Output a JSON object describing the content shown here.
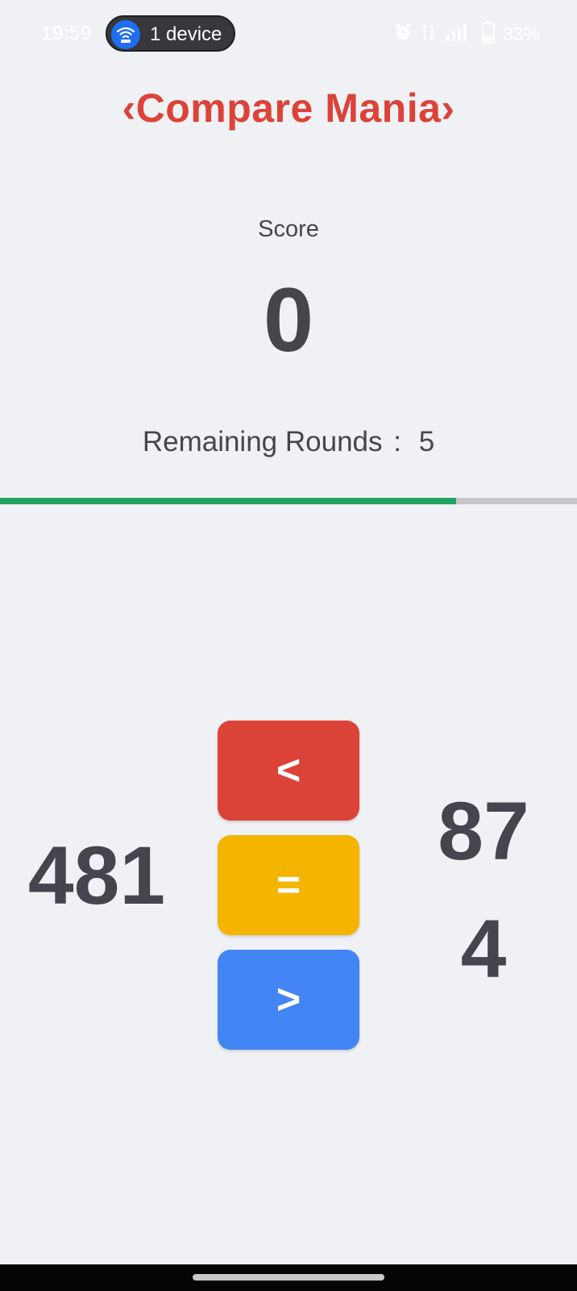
{
  "status_bar": {
    "time": "19:59",
    "device_pill_label": "1 device",
    "battery_text": "33%",
    "icons": [
      "wifi-hotspot-icon",
      "alarm-icon",
      "network-icon",
      "signal-icon",
      "battery-icon"
    ]
  },
  "app": {
    "title": "‹Compare Mania›",
    "title_color": "#dc4338"
  },
  "score": {
    "label": "Score",
    "value": "0"
  },
  "rounds": {
    "label": "Remaining Rounds",
    "separator": ":",
    "value": "5"
  },
  "progress": {
    "fraction": 0.79,
    "fill_color": "#1ea361",
    "track_color": "#c6c6c8"
  },
  "comparison": {
    "left_number": "481",
    "right_number": "87 4",
    "right_number_lines": [
      "87",
      "4"
    ]
  },
  "buttons": {
    "less": {
      "label": "<",
      "color": "#dc4338"
    },
    "equal": {
      "label": "=",
      "color": "#f4b400"
    },
    "greater": {
      "label": ">",
      "color": "#4385f4"
    }
  }
}
